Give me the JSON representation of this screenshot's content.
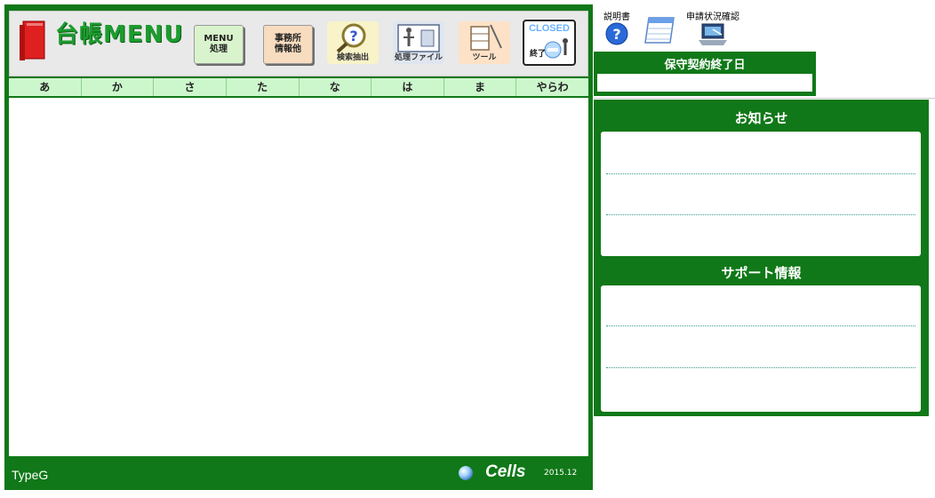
{
  "app": {
    "title": "台帳MENU"
  },
  "toolbar": {
    "menu_button": "MENU\n処理",
    "office_button": "事務所\n情報他",
    "search_label": "検索抽出",
    "file_label": "処理ファイル",
    "tool_label": "ツール",
    "closed_label": "CLOSED",
    "end_label": "終了"
  },
  "kana_tabs": [
    "あ",
    "か",
    "さ",
    "た",
    "な",
    "は",
    "ま",
    "やらわ"
  ],
  "footer": {
    "type": "TypeG",
    "brand": "Cells",
    "version": "2015.12"
  },
  "top_links": {
    "manual": "説明書",
    "status": "申請状況確認"
  },
  "maintenance": {
    "title": "保守契約終了日",
    "value": ""
  },
  "notice": {
    "title": "お知らせ",
    "lines": [
      "",
      "",
      ""
    ]
  },
  "support": {
    "title": "サポート情報",
    "lines": [
      "",
      "",
      ""
    ]
  },
  "colors": {
    "frame_green": "#107818",
    "kana_bg": "#ccf7cc",
    "logo_green": "#1c9c2e"
  }
}
